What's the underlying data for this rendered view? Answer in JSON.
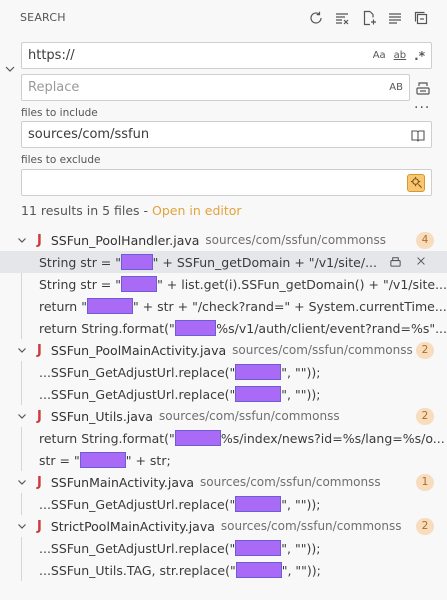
{
  "header": {
    "title": "SEARCH",
    "icons": [
      "refresh-icon",
      "clear-results-icon",
      "new-search-editor-icon",
      "view-as-list-icon",
      "collapse-all-icon"
    ]
  },
  "search": {
    "value": "https://",
    "options": {
      "match_case": "Aa",
      "whole_word": "ab",
      "regex": ".*"
    }
  },
  "replace": {
    "placeholder": "Replace",
    "preserve_case": "AB"
  },
  "include": {
    "label": "files to include",
    "value": "sources/com/ssfun"
  },
  "exclude": {
    "label": "files to exclude",
    "value": ""
  },
  "summary": {
    "text": "11 results in 5 files - ",
    "open_link": "Open in editor"
  },
  "results": [
    {
      "file": "SSFun_PoolHandler.java",
      "path": "sources/com/ssfun/commonss",
      "count": "4",
      "matches": [
        {
          "before": "String str = \"",
          "after": "\" + SSFun_getDomain + \"/v1/site/...",
          "hl_w": 46
        },
        {
          "before": "String str = \"",
          "after": "\" + list.get(i).SSFun_getDomain() + \"/v1/site...",
          "hl_w": 46
        },
        {
          "before": "return \"",
          "after": "\" + str + \"/check?rand=\" + System.currentTime...",
          "hl_w": 46
        },
        {
          "before": "return String.format(\"",
          "after": "%s/v1/auth/client/event?rand=%s\"...",
          "hl_w": 46
        }
      ]
    },
    {
      "file": "SSFun_PoolMainActivity.java",
      "path": "sources/com/ssfun/commonss",
      "count": "2",
      "matches": [
        {
          "before": "...SSFun_GetAdjustUrl.replace(\"",
          "after": "\", \"\"));",
          "hl_w": 46
        },
        {
          "before": "...SSFun_GetAdjustUrl.replace(\"",
          "after": "\", \"\"));",
          "hl_w": 46
        }
      ]
    },
    {
      "file": "SSFun_Utils.java",
      "path": "sources/com/ssfun/commonss",
      "count": "2",
      "matches": [
        {
          "before": "return String.format(\"",
          "after": "%s/index/news?id=%s/lang=%s/o...",
          "hl_w": 46
        },
        {
          "before": "str = \"",
          "after": "\" + str;",
          "hl_w": 46
        }
      ]
    },
    {
      "file": "SSFunMainActivity.java",
      "path": "sources/com/ssfun/commonss",
      "count": "1",
      "matches": [
        {
          "before": "...SSFun_GetAdjustUrl.replace(\"",
          "after": "\", \"\"));",
          "hl_w": 46
        }
      ]
    },
    {
      "file": "StrictPoolMainActivity.java",
      "path": "sources/com/ssfun/commonss",
      "count": "2",
      "matches": [
        {
          "before": "...SSFun_GetAdjustUrl.replace(\"",
          "after": "\", \"\"));",
          "hl_w": 46
        },
        {
          "before": "...SSFun_Utils.TAG, str.replace(\"",
          "after": "\", \"\"));",
          "hl_w": 46
        }
      ]
    }
  ],
  "colors": {
    "badge_bg": "#f7dcbe",
    "badge_fg": "#b26b22",
    "highlight": "#a96bf5",
    "java_icon": "#cc3a3a",
    "link": "#e2a33c"
  }
}
